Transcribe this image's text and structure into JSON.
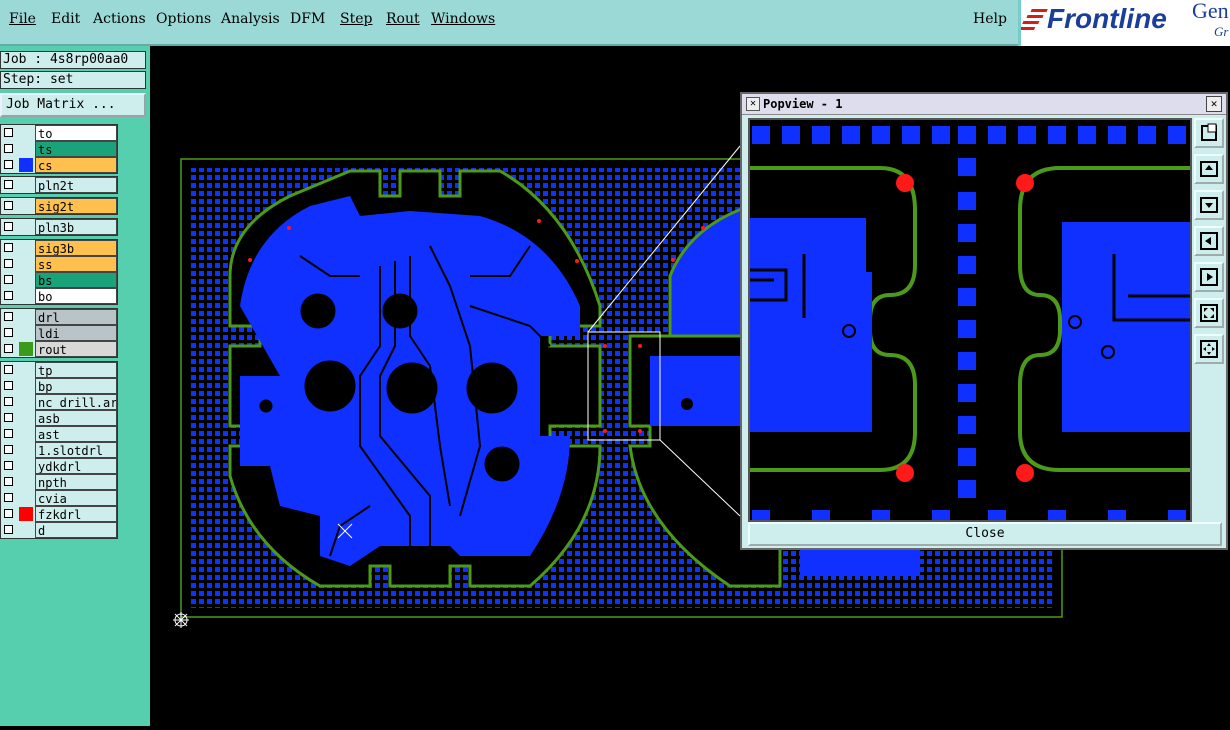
{
  "menubar": {
    "items": [
      "File",
      "Edit",
      "Actions",
      "Options",
      "Analysis",
      "DFM",
      "Step",
      "Rout",
      "Windows"
    ],
    "help": "Help"
  },
  "logo": {
    "brand": "Frontline",
    "product": "Gen",
    "sub": "Gr"
  },
  "sidebar": {
    "job": "Job : 4s8rp00aa0",
    "step": "Step: set",
    "job_matrix": "Job Matrix ...",
    "layers": [
      {
        "name": "to",
        "bg": "#ffffff",
        "swatch": ""
      },
      {
        "name": "ts",
        "bg": "#1aa37a",
        "swatch": ""
      },
      {
        "name": "cs",
        "bg": "#ffc04d",
        "swatch": "#1030ff"
      },
      {
        "name": "pln2t",
        "bg": "#cdeeed",
        "swatch": ""
      },
      {
        "name": "sig2t",
        "bg": "#ffc04d",
        "swatch": ""
      },
      {
        "name": "pln3b",
        "bg": "#cdeeed",
        "swatch": ""
      },
      {
        "name": "sig3b",
        "bg": "#ffc04d",
        "swatch": ""
      },
      {
        "name": "ss",
        "bg": "#ffc04d",
        "swatch": ""
      },
      {
        "name": "bs",
        "bg": "#1aa37a",
        "swatch": ""
      },
      {
        "name": "bo",
        "bg": "#ffffff",
        "swatch": ""
      },
      {
        "name": "drl",
        "bg": "#b8c4c8",
        "swatch": ""
      },
      {
        "name": "ldi",
        "bg": "#b8c4c8",
        "swatch": ""
      },
      {
        "name": "rout",
        "bg": "#d8d8d8",
        "swatch": "#3a9a1a"
      },
      {
        "name": "tp",
        "bg": "#cdeeed",
        "swatch": ""
      },
      {
        "name": "bp",
        "bg": "#cdeeed",
        "swatch": ""
      },
      {
        "name": "nc_drill.art",
        "bg": "#cdeeed",
        "swatch": ""
      },
      {
        "name": "asb",
        "bg": "#cdeeed",
        "swatch": ""
      },
      {
        "name": "ast",
        "bg": "#cdeeed",
        "swatch": ""
      },
      {
        "name": "1.slotdrl",
        "bg": "#cdeeed",
        "swatch": ""
      },
      {
        "name": "ydkdrl",
        "bg": "#cdeeed",
        "swatch": ""
      },
      {
        "name": "npth",
        "bg": "#cdeeed",
        "swatch": ""
      },
      {
        "name": "cvia",
        "bg": "#cdeeed",
        "swatch": ""
      },
      {
        "name": "fzkdrl",
        "bg": "#cdeeed",
        "swatch": "#ff0000"
      },
      {
        "name": "d",
        "bg": "#cdeeed",
        "swatch": ""
      }
    ]
  },
  "popview": {
    "title": "Popview - 1",
    "close": "Close",
    "tools": [
      "zoom-window-icon",
      "zoom-in-icon",
      "zoom-out-icon",
      "pan-left-icon",
      "pan-right-icon",
      "zoom-fit-icon",
      "pan-center-icon"
    ]
  },
  "colors": {
    "copper": "#1030ff",
    "outline": "#4c9a1a",
    "drill": "#ff1a1a",
    "menubar": "#9ad9d6",
    "sidebar": "#55cfae"
  }
}
